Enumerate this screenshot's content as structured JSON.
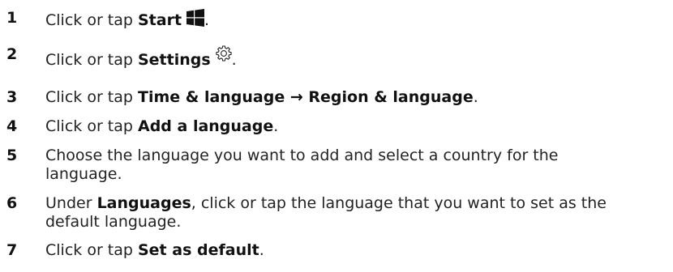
{
  "steps": [
    {
      "number": "1",
      "prefix": "Click or tap ",
      "bold": "Start",
      "suffix": "."
    },
    {
      "number": "2",
      "prefix": "Click or tap ",
      "bold": "Settings",
      "suffix": "."
    },
    {
      "number": "3",
      "prefix": "Click or tap ",
      "bold": "Time & language",
      "arrow": " → ",
      "bold2": "Region & language",
      "suffix": "."
    },
    {
      "number": "4",
      "prefix": "Click or tap ",
      "bold": "Add a language",
      "suffix": "."
    },
    {
      "number": "5",
      "line1": "Choose the language you want to add and select a country for the",
      "line2": "language."
    },
    {
      "number": "6",
      "prefix": "Under ",
      "bold": "Languages",
      "suffix": ", click or tap the language that you want to set as the",
      "line2": "default language."
    },
    {
      "number": "7",
      "prefix": "Click or tap ",
      "bold": "Set as default",
      "suffix": "."
    }
  ],
  "icons": {
    "start": "windows-logo-icon",
    "settings": "gear-icon"
  }
}
